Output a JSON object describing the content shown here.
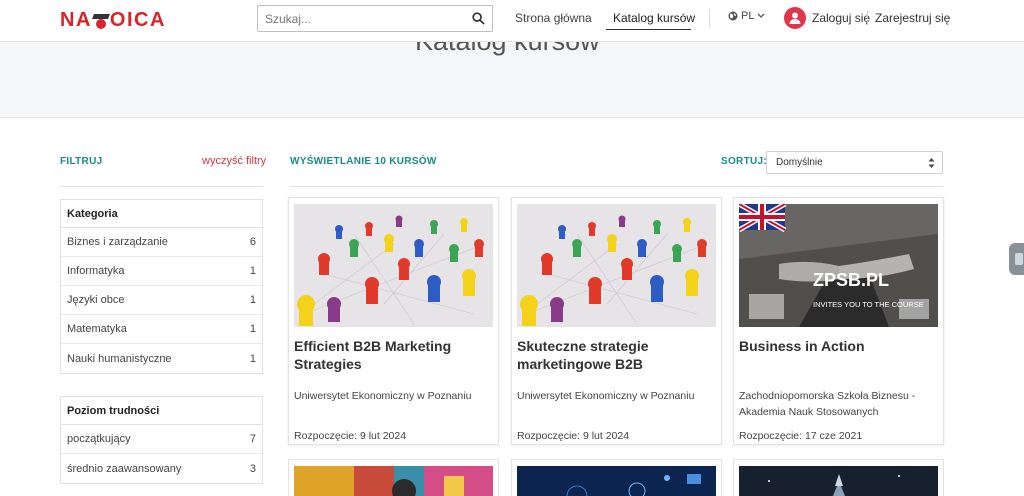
{
  "header": {
    "logo_text": "NAVOICA",
    "search_placeholder": "Szukaj...",
    "nav": {
      "home": "Strona główna",
      "catalog": "Katalog kursów"
    },
    "language": "PL",
    "login": "Zaloguj się",
    "register": "Zarejestruj się"
  },
  "hero": {
    "title": "Katalog kursów"
  },
  "filters": {
    "heading": "FILTRUJ",
    "clear": "wyczyść filtry",
    "groups": [
      {
        "title": "Kategoria",
        "items": [
          {
            "label": "Biznes i zarządzanie",
            "count": "6"
          },
          {
            "label": "Informatyka",
            "count": "1"
          },
          {
            "label": "Języki obce",
            "count": "1"
          },
          {
            "label": "Matematyka",
            "count": "1"
          },
          {
            "label": "Nauki humanistyczne",
            "count": "1"
          }
        ]
      },
      {
        "title": "Poziom trudności",
        "items": [
          {
            "label": "początkujący",
            "count": "7"
          },
          {
            "label": "średnio zaawansowany",
            "count": "3"
          }
        ]
      }
    ]
  },
  "listing": {
    "showing": "WYŚWIETLANIE 10 KURSÓW",
    "sort_label": "SORTUJ:",
    "sort_value": "Domyślnie"
  },
  "courses": [
    {
      "title": "Efficient B2B Marketing Strategies",
      "university": "Uniwersytet Ekonomiczny w Poznaniu",
      "start": "Rozpoczęcie: 9 lut 2024"
    },
    {
      "title": "Skuteczne strategie marketingowe B2B",
      "university": "Uniwersytet Ekonomiczny w Poznaniu",
      "start": "Rozpoczęcie: 9 lut 2024"
    },
    {
      "title": "Business in Action",
      "university": "Zachodniopomorska Szkoła Biznesu - Akademia Nauk Stosowanych",
      "start": "Rozpoczęcie: 17 cze 2021",
      "image_text_1": "ZPSB.PL",
      "image_text_2": "INVITES YOU TO THE COURSE"
    }
  ],
  "colors": {
    "brand_red": "#d8252b",
    "accent_teal": "#168b87",
    "link_red": "#d3363e"
  }
}
